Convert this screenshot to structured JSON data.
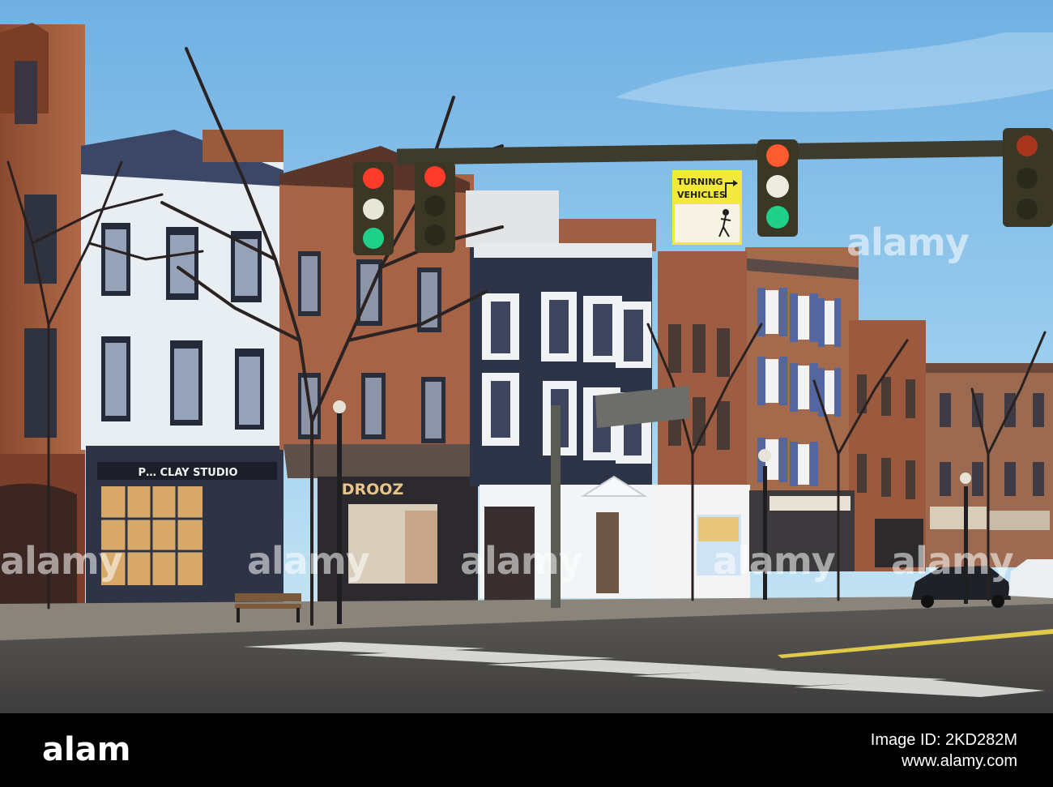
{
  "photo": {
    "signs": {
      "turning_line1": "TURNING",
      "turning_line2": "VEHICLES",
      "store_drooz": "DROOZ",
      "store_clay": "P… CLAY STUDIO"
    }
  },
  "watermark": {
    "text": "alamy"
  },
  "footer": {
    "logo_text": "alamy",
    "image_id": "Image ID: 2KD282M",
    "url": "www.alamy.com"
  },
  "colors": {
    "sky": "#8fc4ea",
    "brick": "#9b5a3e",
    "white_building": "#e9eef3",
    "navy_building": "#2d3447",
    "road": "#4a4a4a",
    "signal_body": "#3a3724",
    "signal_red": "#ff3b2a",
    "signal_green": "#1fd08a",
    "sign_yellow": "#f2e93c"
  }
}
